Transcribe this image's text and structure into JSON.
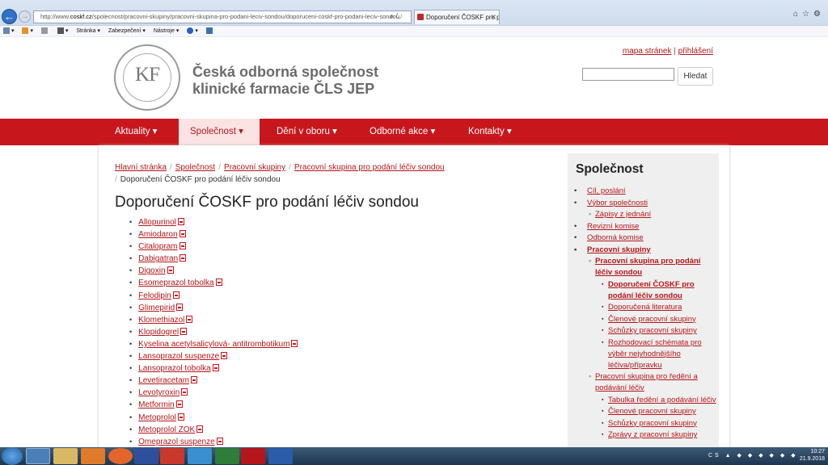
{
  "browser": {
    "url_prefix": "http://www.",
    "url_domain": "coskf.cz",
    "url_path": "/spolecnost/pracovni-skupiny/pracovni-skupina-pro-podani-leciv-sondou/doporuceni-coskf-pro-podani-leciv-sondou",
    "tab_title": "Doporučení ČOSKF pro podá...",
    "commands": [
      "Stránka",
      "Zabezpečení",
      "Nástroje"
    ]
  },
  "header": {
    "org_name_line1": "Česká odborná společnost",
    "org_name_line2": "klinické farmacie ČLS JEP",
    "logo_text": "KF",
    "link_sitemap": "mapa stránek",
    "link_separator": "|",
    "link_login": "přihlášení",
    "search_button": "Hledat",
    "search_value": ""
  },
  "nav": [
    {
      "label": "Aktuality",
      "active": false
    },
    {
      "label": "Společnost",
      "active": true
    },
    {
      "label": "Dění v oboru",
      "active": false
    },
    {
      "label": "Odborné akce",
      "active": false
    },
    {
      "label": "Kontakty",
      "active": false
    }
  ],
  "breadcrumb": {
    "home": "Hlavní stránka",
    "society": "Společnost",
    "groups": "Pracovní skupiny",
    "group": "Pracovní skupina pro podání léčiv sondou",
    "current": "Doporučení ČOSKF pro podání léčiv sondou"
  },
  "main": {
    "title": "Doporučení ČOSKF pro podání léčiv sondou",
    "drugs": [
      "Allopurinol",
      "Amiodaron",
      "Citalopram",
      "Dabigatran",
      "Digoxin",
      "Esomeprazol tobolka",
      "Felodipin",
      "Glimepirid",
      "Klomethiazol",
      "Klopidogrel",
      "Kyselina acetylsalicylová- antitrombotikum",
      "Lansoprazol suspenze",
      "Lansoprazol tobolka",
      "Levetiracetam",
      "Levotyroxin",
      "Metformin",
      "Metoprolol",
      "Metoprolol ZOK",
      "Omeprazol suspenze"
    ]
  },
  "sidebar": {
    "title": "Společnost",
    "items": [
      {
        "label": "Cíl, poslání",
        "level": 1,
        "bold": false
      },
      {
        "label": "Výbor společnosti",
        "level": 1,
        "bold": false
      },
      {
        "label": "Zápisy z jednání",
        "level": 2,
        "bold": false
      },
      {
        "label": "Revizní komise",
        "level": 1,
        "bold": false
      },
      {
        "label": "Odborná komise",
        "level": 1,
        "bold": false
      },
      {
        "label": "Pracovní skupiny",
        "level": 1,
        "bold": true
      },
      {
        "label": "Pracovní skupina pro podání léčiv sondou",
        "level": 2,
        "bold": true
      },
      {
        "label": "Doporučení ČOSKF pro podání léčiv sondou",
        "level": 3,
        "bold": true
      },
      {
        "label": "Doporučená literatura",
        "level": 3,
        "bold": false
      },
      {
        "label": "Členové pracovní skupiny",
        "level": 3,
        "bold": false
      },
      {
        "label": "Schůzky pracovní skupiny",
        "level": 3,
        "bold": false
      },
      {
        "label": "Rozhodovací schémata pro výběr nejvhodnějšího léčiva/přípravku",
        "level": 3,
        "bold": false
      },
      {
        "label": "Pracovní skupina pro ředění a podávání léčiv",
        "level": 2,
        "bold": false
      },
      {
        "label": "Tabulka ředění a podávání léčiv",
        "level": 3,
        "bold": false
      },
      {
        "label": "Členové pracovní skupiny",
        "level": 3,
        "bold": false
      },
      {
        "label": "Schůzky pracovní skupiny",
        "level": 3,
        "bold": false
      },
      {
        "label": "Zprávy z pracovní skupiny",
        "level": 3,
        "bold": false
      }
    ]
  },
  "taskbar": {
    "lang": "CS",
    "time": "10:27",
    "date": "21.9.2018"
  },
  "colors": {
    "brand_red": "#c8161d",
    "link_red": "#b3161b",
    "nav_active_bg": "#fbe3e4"
  }
}
